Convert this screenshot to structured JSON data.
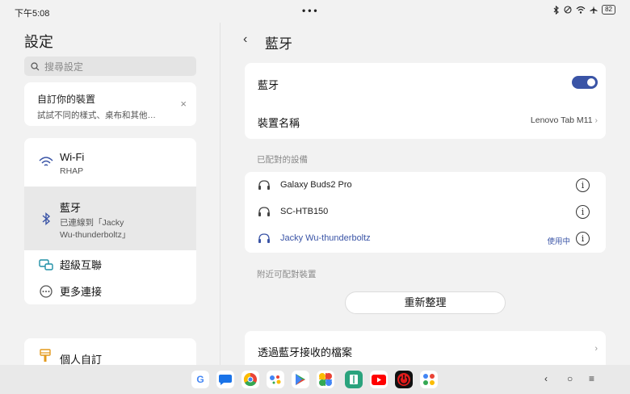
{
  "status": {
    "time": "下午5:08",
    "battery": "82"
  },
  "left": {
    "title": "設定",
    "search_placeholder": "搜尋設定",
    "customize": {
      "title": "自訂你的裝置",
      "subtitle": "試試不同的樣式、桌布和其他…",
      "close": "×"
    },
    "items": [
      {
        "title": "Wi-Fi",
        "subtitle": "RHAP"
      },
      {
        "title": "藍牙",
        "subtitle_line1": "已連線到「Jacky",
        "subtitle_line2": "Wu-thunderboltz」"
      },
      {
        "title": "超級互聯"
      },
      {
        "title": "更多連接"
      }
    ],
    "personal": {
      "title": "個人自訂"
    }
  },
  "right": {
    "back": "‹",
    "title": "藍牙",
    "bluetooth_label": "藍牙",
    "bluetooth_on": true,
    "device_name_label": "裝置名稱",
    "device_name_value": "Lenovo Tab M11",
    "paired_label": "已配對的設備",
    "paired_devices": [
      {
        "name": "Galaxy Buds2 Pro",
        "state": ""
      },
      {
        "name": "SC-HTB150",
        "state": ""
      },
      {
        "name": "Jacky Wu-thunderboltz",
        "state": "使用中"
      }
    ],
    "nearby_label": "附近可配對裝置",
    "refresh_label": "重新整理",
    "received_files_label": "透過藍牙接收的檔案"
  },
  "navbar": {
    "apps": [
      "google-icon",
      "messages-icon",
      "chrome-icon",
      "assistant-icon",
      "play-store-icon",
      "photos-icon",
      "files-icon",
      "youtube-icon",
      "power-app-icon",
      "app-drawer-icon"
    ],
    "colors": {
      "accent": "#3a54a6"
    }
  }
}
